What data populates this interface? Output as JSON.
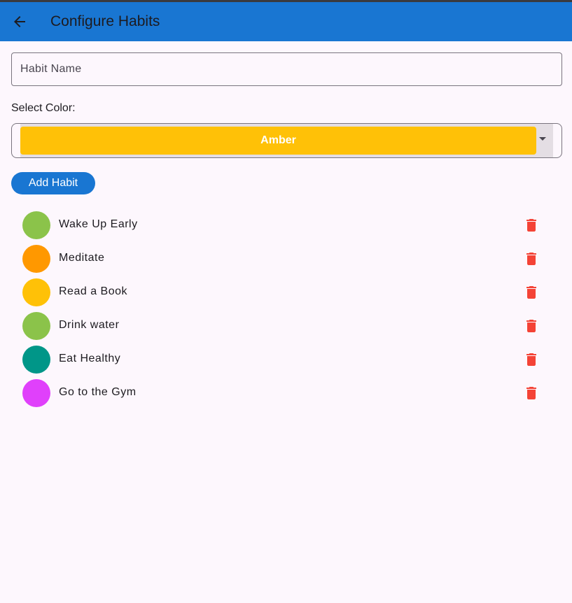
{
  "appbar": {
    "title": "Configure Habits",
    "back_icon": "arrow-back-icon",
    "color": "#1976d2"
  },
  "form": {
    "habit_name_placeholder": "Habit Name",
    "habit_name_value": "",
    "select_color_label": "Select Color:",
    "selected_color": {
      "name": "Amber",
      "hex": "#ffc107"
    },
    "add_button_label": "Add Habit"
  },
  "habits": [
    {
      "name": "Wake Up Early",
      "color": "#8bc34a"
    },
    {
      "name": "Meditate",
      "color": "#ff9800"
    },
    {
      "name": "Read a Book",
      "color": "#ffc107"
    },
    {
      "name": "Drink water",
      "color": "#8bc34a"
    },
    {
      "name": "Eat Healthy",
      "color": "#009688"
    },
    {
      "name": "Go to the Gym",
      "color": "#e040fb"
    }
  ],
  "delete_icon": "trash-icon",
  "delete_icon_color": "#f44336"
}
